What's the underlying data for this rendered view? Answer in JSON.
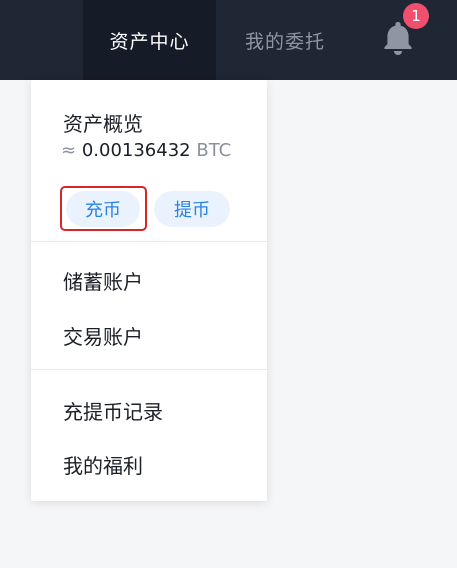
{
  "header": {
    "nav_asset_center": "资产中心",
    "nav_my_orders": "我的委托",
    "bell_icon": "bell-icon",
    "notification_count": "1"
  },
  "dropdown": {
    "overview_title": "资产概览",
    "approx_symbol": "≈",
    "balance_value": "0.00136432",
    "balance_unit": "BTC",
    "deposit_label": "充币",
    "withdraw_label": "提币",
    "menu_group1": [
      "储蓄账户",
      "交易账户"
    ],
    "menu_group2": [
      "充提币记录",
      "我的福利"
    ]
  },
  "colors": {
    "topbar_bg": "#1f2634",
    "active_tab_bg": "#151b27",
    "badge": "#f0506e",
    "pill_bg": "#eaf3fd",
    "pill_text": "#2a82e4",
    "highlight": "#d6252b"
  }
}
